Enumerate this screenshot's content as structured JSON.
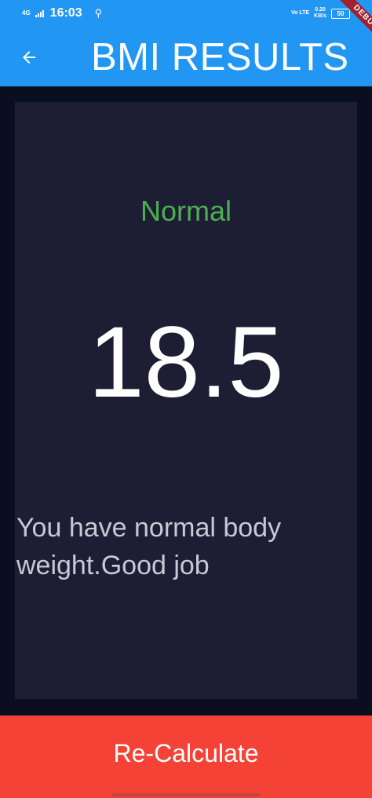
{
  "status_bar": {
    "network": "4G",
    "time": "16:03",
    "volte": "Vo LTE",
    "speed_value": "0.20",
    "speed_unit": "KB/s",
    "battery": "50"
  },
  "app_bar": {
    "title": "BMI RESULTS",
    "back_icon": "arrow-back-icon"
  },
  "debug_banner": "DEBUG",
  "result": {
    "status": "Normal",
    "bmi": "18.5",
    "interpretation": "You have normal body weight.Good job"
  },
  "bottom_button": {
    "label": "Re-Calculate"
  },
  "colors": {
    "primary": "#2196f3",
    "background": "#0a0e21",
    "card": "#1d1e33",
    "status_normal": "#4caf50",
    "button": "#f44336"
  }
}
